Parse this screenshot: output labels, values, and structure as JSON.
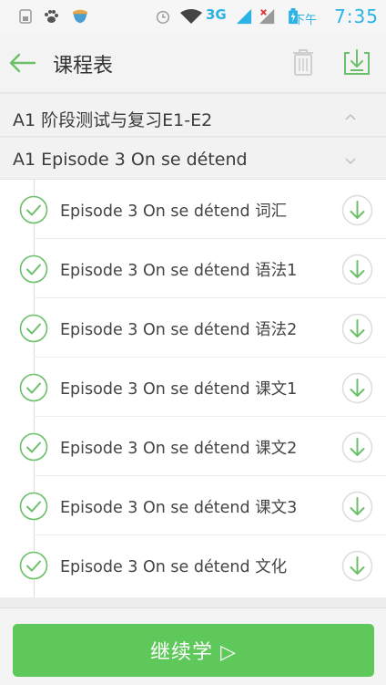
{
  "status_bar": {
    "network": "3G",
    "ampm": "下午",
    "time": "7:35",
    "icons": [
      "storage-icon",
      "paw-app-icon",
      "cup-app-icon",
      "alarm-icon",
      "wifi-icon",
      "signal-icon",
      "signal-no-service-icon",
      "battery-charging-icon"
    ]
  },
  "header": {
    "title": "课程表",
    "back_icon": "arrow-left-icon",
    "delete_icon": "trash-icon",
    "download_icon": "download-tray-icon"
  },
  "sections": [
    {
      "title": "A1 阶段测试与复习E1-E2",
      "expanded": false
    },
    {
      "title": "A1 Episode 3 On se détend",
      "expanded": true
    }
  ],
  "lessons": [
    {
      "label": "Episode 3 On se détend 词汇"
    },
    {
      "label": "Episode 3 On se détend 语法1"
    },
    {
      "label": "Episode 3 On se détend 语法2"
    },
    {
      "label": "Episode 3 On se détend 课文1"
    },
    {
      "label": "Episode 3 On se détend 课文2"
    },
    {
      "label": "Episode 3 On se détend 课文3"
    },
    {
      "label": "Episode 3 On se détend 文化"
    }
  ],
  "footer": {
    "continue_label": "继续学 ▷"
  },
  "colors": {
    "accent_green": "#5ec85a",
    "icon_green": "#6cc06a",
    "status_blue": "#2bb3e6"
  }
}
